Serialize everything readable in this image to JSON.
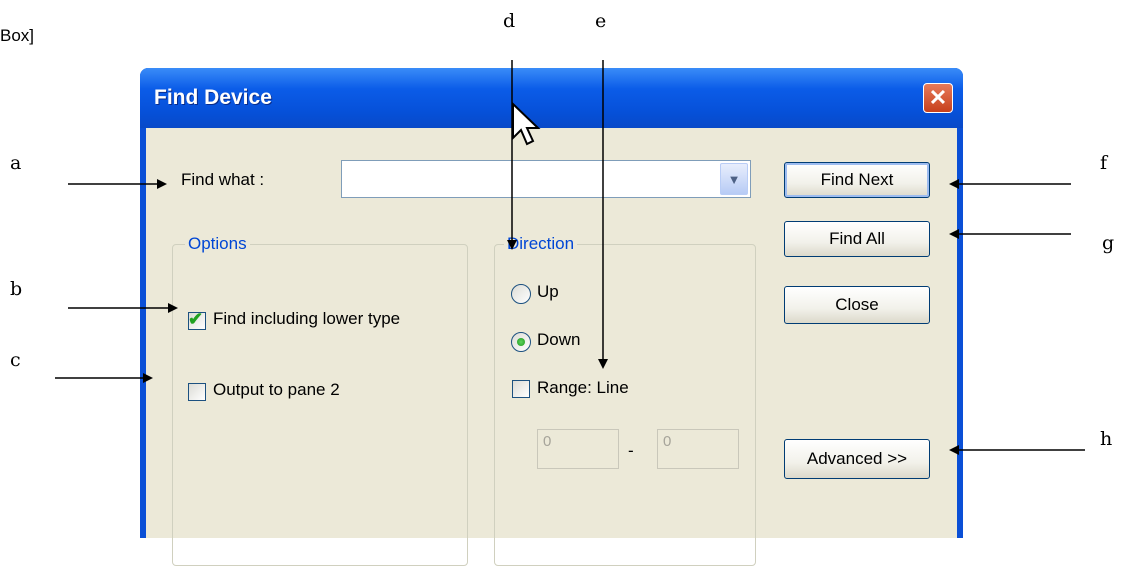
{
  "page_note": "Box]",
  "annotations": {
    "a": "a",
    "b": "b",
    "c": "c",
    "d": "d",
    "e": "e",
    "f": "f",
    "g": "g",
    "h": "h"
  },
  "dialog": {
    "title": "Find Device",
    "close_glyph": "✕",
    "find_what_label": "Find what :",
    "find_what_value": "",
    "options": {
      "legend": "Options",
      "include_lower_label": "Find including lower type",
      "include_lower_checked": true,
      "output_pane_label": "Output to pane 2",
      "output_pane_checked": false
    },
    "direction": {
      "legend": "Direction",
      "up_label": "Up",
      "down_label": "Down",
      "selected": "Down",
      "range_label": "Range: Line",
      "range_checked": false,
      "range_from": "0",
      "range_sep": "-",
      "range_to": "0"
    },
    "buttons": {
      "find_next": "Find Next",
      "find_all": "Find All",
      "close": "Close",
      "advanced": "Advanced >>"
    }
  },
  "colors": {
    "titlebar": "#0650d8",
    "face": "#ece9d8",
    "accent_blue": "#0046d5",
    "check_green": "#21a121"
  },
  "icons": {
    "combo": "chevron-down-icon",
    "check": "checkmark-icon",
    "close": "close-icon",
    "cursor": "mouse-pointer-icon"
  }
}
